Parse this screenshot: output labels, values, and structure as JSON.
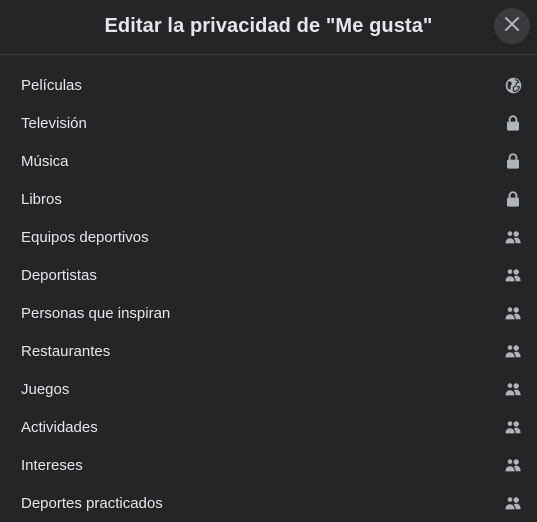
{
  "dialog": {
    "title": "Editar la privacidad de \"Me gusta\""
  },
  "colors": {
    "background": "#242526",
    "text": "#e4e6eb",
    "icon": "#b0b3b8",
    "close_button_bg": "#3a3b3c"
  },
  "items": [
    {
      "label": "Películas",
      "privacy_icon": "globe-icon"
    },
    {
      "label": "Televisión",
      "privacy_icon": "lock-icon"
    },
    {
      "label": "Música",
      "privacy_icon": "lock-icon"
    },
    {
      "label": "Libros",
      "privacy_icon": "lock-icon"
    },
    {
      "label": "Equipos deportivos",
      "privacy_icon": "friends-icon"
    },
    {
      "label": "Deportistas",
      "privacy_icon": "friends-icon"
    },
    {
      "label": "Personas que inspiran",
      "privacy_icon": "friends-icon"
    },
    {
      "label": "Restaurantes",
      "privacy_icon": "friends-icon"
    },
    {
      "label": "Juegos",
      "privacy_icon": "friends-icon"
    },
    {
      "label": "Actividades",
      "privacy_icon": "friends-icon"
    },
    {
      "label": "Intereses",
      "privacy_icon": "friends-icon"
    },
    {
      "label": "Deportes practicados",
      "privacy_icon": "friends-icon"
    }
  ]
}
